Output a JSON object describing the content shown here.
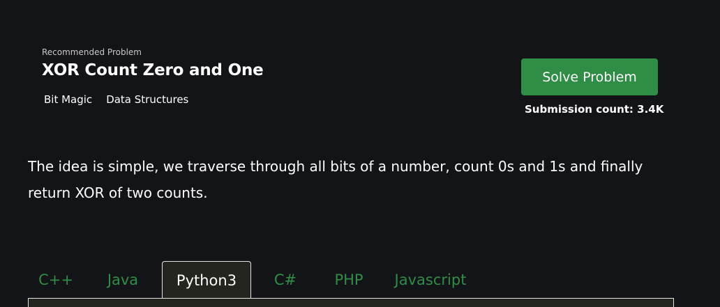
{
  "problem": {
    "recommended_label": "Recommended Problem",
    "title": "XOR Count Zero and One",
    "tags": [
      "Bit Magic",
      "Data Structures"
    ],
    "solve_button_label": "Solve Problem",
    "submission_count": "Submission count: 3.4K"
  },
  "description": "The idea is simple, we traverse through all bits of a number, count 0s and 1s and finally return XOR of two counts.",
  "code_tabs": {
    "active": "Python3",
    "items": [
      {
        "label": "C++"
      },
      {
        "label": "Java"
      },
      {
        "label": "Python3"
      },
      {
        "label": "C#"
      },
      {
        "label": "PHP"
      },
      {
        "label": "Javascript"
      }
    ]
  },
  "colors": {
    "background": "#131417",
    "accent_green": "#2f8d46",
    "text": "#ffffff",
    "code_bg": "#24251f"
  }
}
